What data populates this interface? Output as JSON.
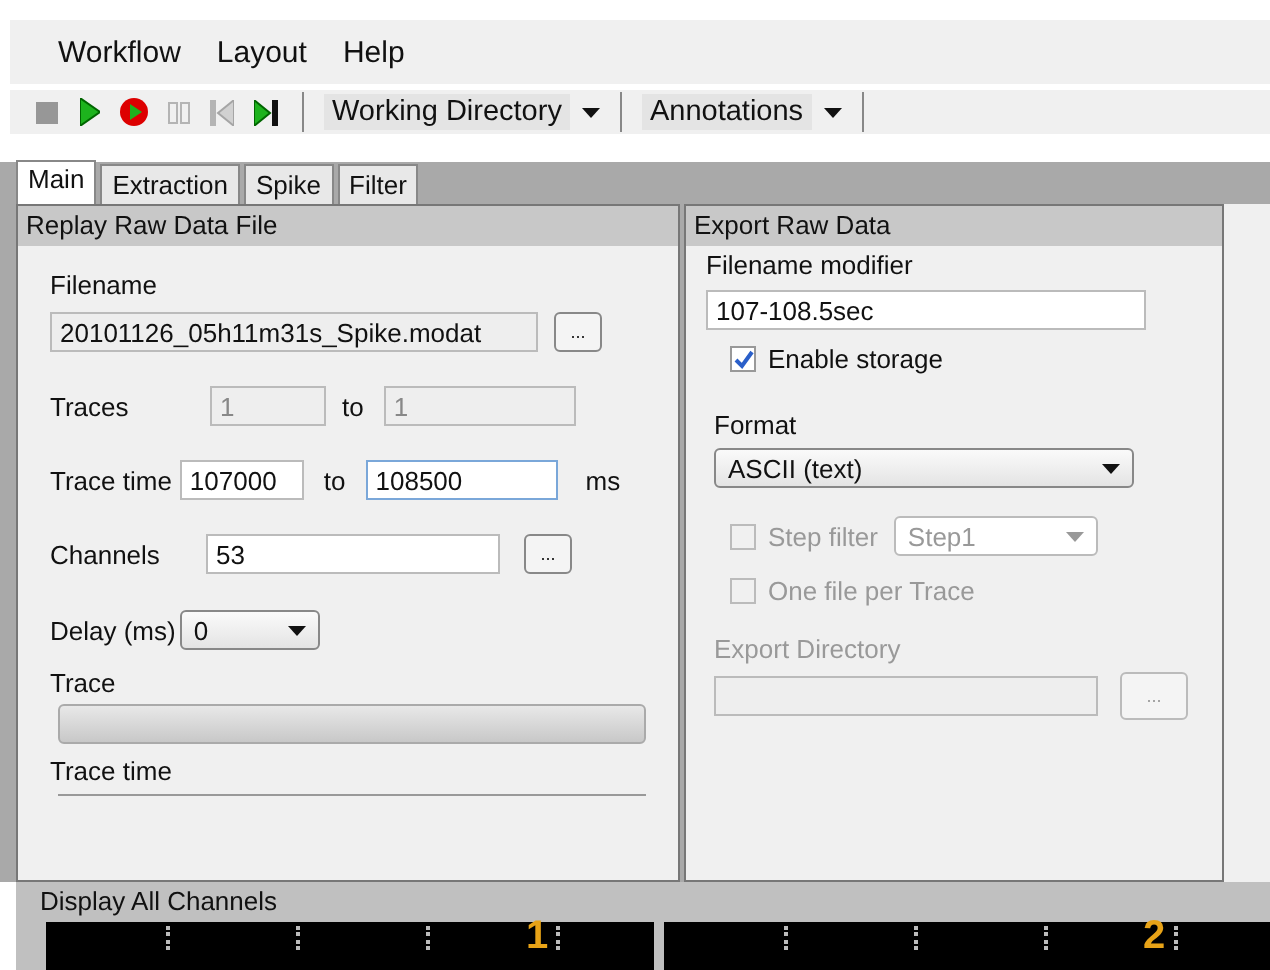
{
  "menu": [
    "Workflow",
    "Layout",
    "Help"
  ],
  "toolbar": {
    "buttons": [
      {
        "kind": "stop",
        "disabled": true
      },
      {
        "kind": "play",
        "disabled": false
      },
      {
        "kind": "record",
        "disabled": false
      },
      {
        "kind": "pause",
        "disabled": true
      },
      {
        "kind": "rewind",
        "disabled": true
      },
      {
        "kind": "step",
        "disabled": false
      }
    ],
    "dropdowns": [
      "Working Directory",
      "Annotations"
    ]
  },
  "tabs": [
    {
      "label": "Main",
      "selected": true
    },
    {
      "label": "Extraction",
      "selected": false
    },
    {
      "label": "Spike",
      "selected": false
    },
    {
      "label": "Filter",
      "selected": false
    }
  ],
  "replay_panel": {
    "title": "Replay Raw Data File",
    "filename": {
      "label": "Filename",
      "value": "20101126_05h11m31s_Spike.modat",
      "button": "..."
    },
    "traces": {
      "label": "Traces",
      "from": "1",
      "to_label": "to",
      "to": "1",
      "disabled": true
    },
    "trace_time": {
      "label": "Trace time",
      "from": "107000",
      "to_label": "to",
      "to": "108500",
      "unit": "ms",
      "disabled": false
    },
    "channels": {
      "label": "Channels",
      "value": "53",
      "button": "..."
    },
    "delay": {
      "label": "Delay (ms)",
      "value": "0"
    },
    "trace": {
      "label": "Trace",
      "level": 0
    },
    "trace_time_label": "Trace time"
  },
  "export_panel": {
    "title": "Export Raw Data",
    "filename_modifier": {
      "label": "Filename modifier",
      "value": "107-108.5sec"
    },
    "enable_storage": {
      "label": "Enable storage",
      "checked": true,
      "disabled": false
    },
    "format": {
      "label": "Format",
      "value": "ASCII (text)"
    },
    "step_filter": {
      "label": "Step filter",
      "checked": false,
      "disabled": true,
      "value": "Step1"
    },
    "one_file_per_trace": {
      "label": "One file per Trace",
      "checked": false,
      "disabled": true
    },
    "export_directory": {
      "label": "Export Directory",
      "disabled": true,
      "button": "..."
    }
  },
  "display": {
    "title": "Display All Channels",
    "channels": [
      {
        "label": "1"
      },
      {
        "label": "2"
      }
    ]
  }
}
